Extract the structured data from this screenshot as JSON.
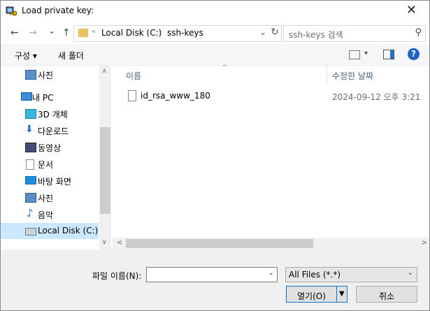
{
  "window": {
    "title": "Load private key:",
    "close_glyph": "✕"
  },
  "nav": {
    "back_glyph": "←",
    "forward_glyph": "→",
    "recent_glyph": "⌄",
    "up_glyph": "↑",
    "path_separator": "«",
    "breadcrumbs": [
      "Local Disk (C:)",
      "ssh-keys"
    ],
    "crumb_chevron": "›",
    "address_dropdown_glyph": "⌄",
    "refresh_glyph": "↻",
    "search_placeholder": "ssh-keys 검색",
    "search_icon_glyph": "⚲"
  },
  "toolbar": {
    "organize_label": "구성 ▾",
    "new_folder_label": "새 폴더",
    "help_glyph": "?",
    "view_dropdown_glyph": "▾"
  },
  "sidebar": {
    "items": [
      {
        "label": "사진",
        "icon": "pictures-icon"
      },
      {
        "label": "내 PC",
        "icon": "pc-icon"
      },
      {
        "label": "3D 개체",
        "icon": "3d-objects-icon"
      },
      {
        "label": "다운로드",
        "icon": "download-icon"
      },
      {
        "label": "동영상",
        "icon": "videos-icon"
      },
      {
        "label": "문서",
        "icon": "documents-icon"
      },
      {
        "label": "바탕 화면",
        "icon": "desktop-icon"
      },
      {
        "label": "사진",
        "icon": "pictures-icon"
      },
      {
        "label": "음악",
        "icon": "music-icon"
      },
      {
        "label": "Local Disk (C:)",
        "icon": "drive-icon"
      }
    ],
    "scroll_up_glyph": "∧",
    "scroll_down_glyph": "∨"
  },
  "filelist": {
    "columns": {
      "name": "이름",
      "modified": "수정한 날짜"
    },
    "sort_glyph": "^",
    "files": [
      {
        "name": "id_rsa_www_180",
        "modified": "2024-09-12 오후 3:21"
      }
    ],
    "hscroll_left_glyph": "<",
    "hscroll_right_glyph": ">"
  },
  "bottom": {
    "filename_label": "파일 이름(N):",
    "filename_value": "",
    "filename_dropdown_glyph": "⌄",
    "filter_value": "All Files (*.*)",
    "filter_dropdown_glyph": "⌄",
    "open_label": "열기(O)",
    "open_dropdown_glyph": "▼",
    "cancel_label": "취소"
  },
  "colors": {
    "selection": "#cce8ff",
    "accent": "#0078d7",
    "help": "#1e63c8",
    "folder": "#e9c15a"
  }
}
